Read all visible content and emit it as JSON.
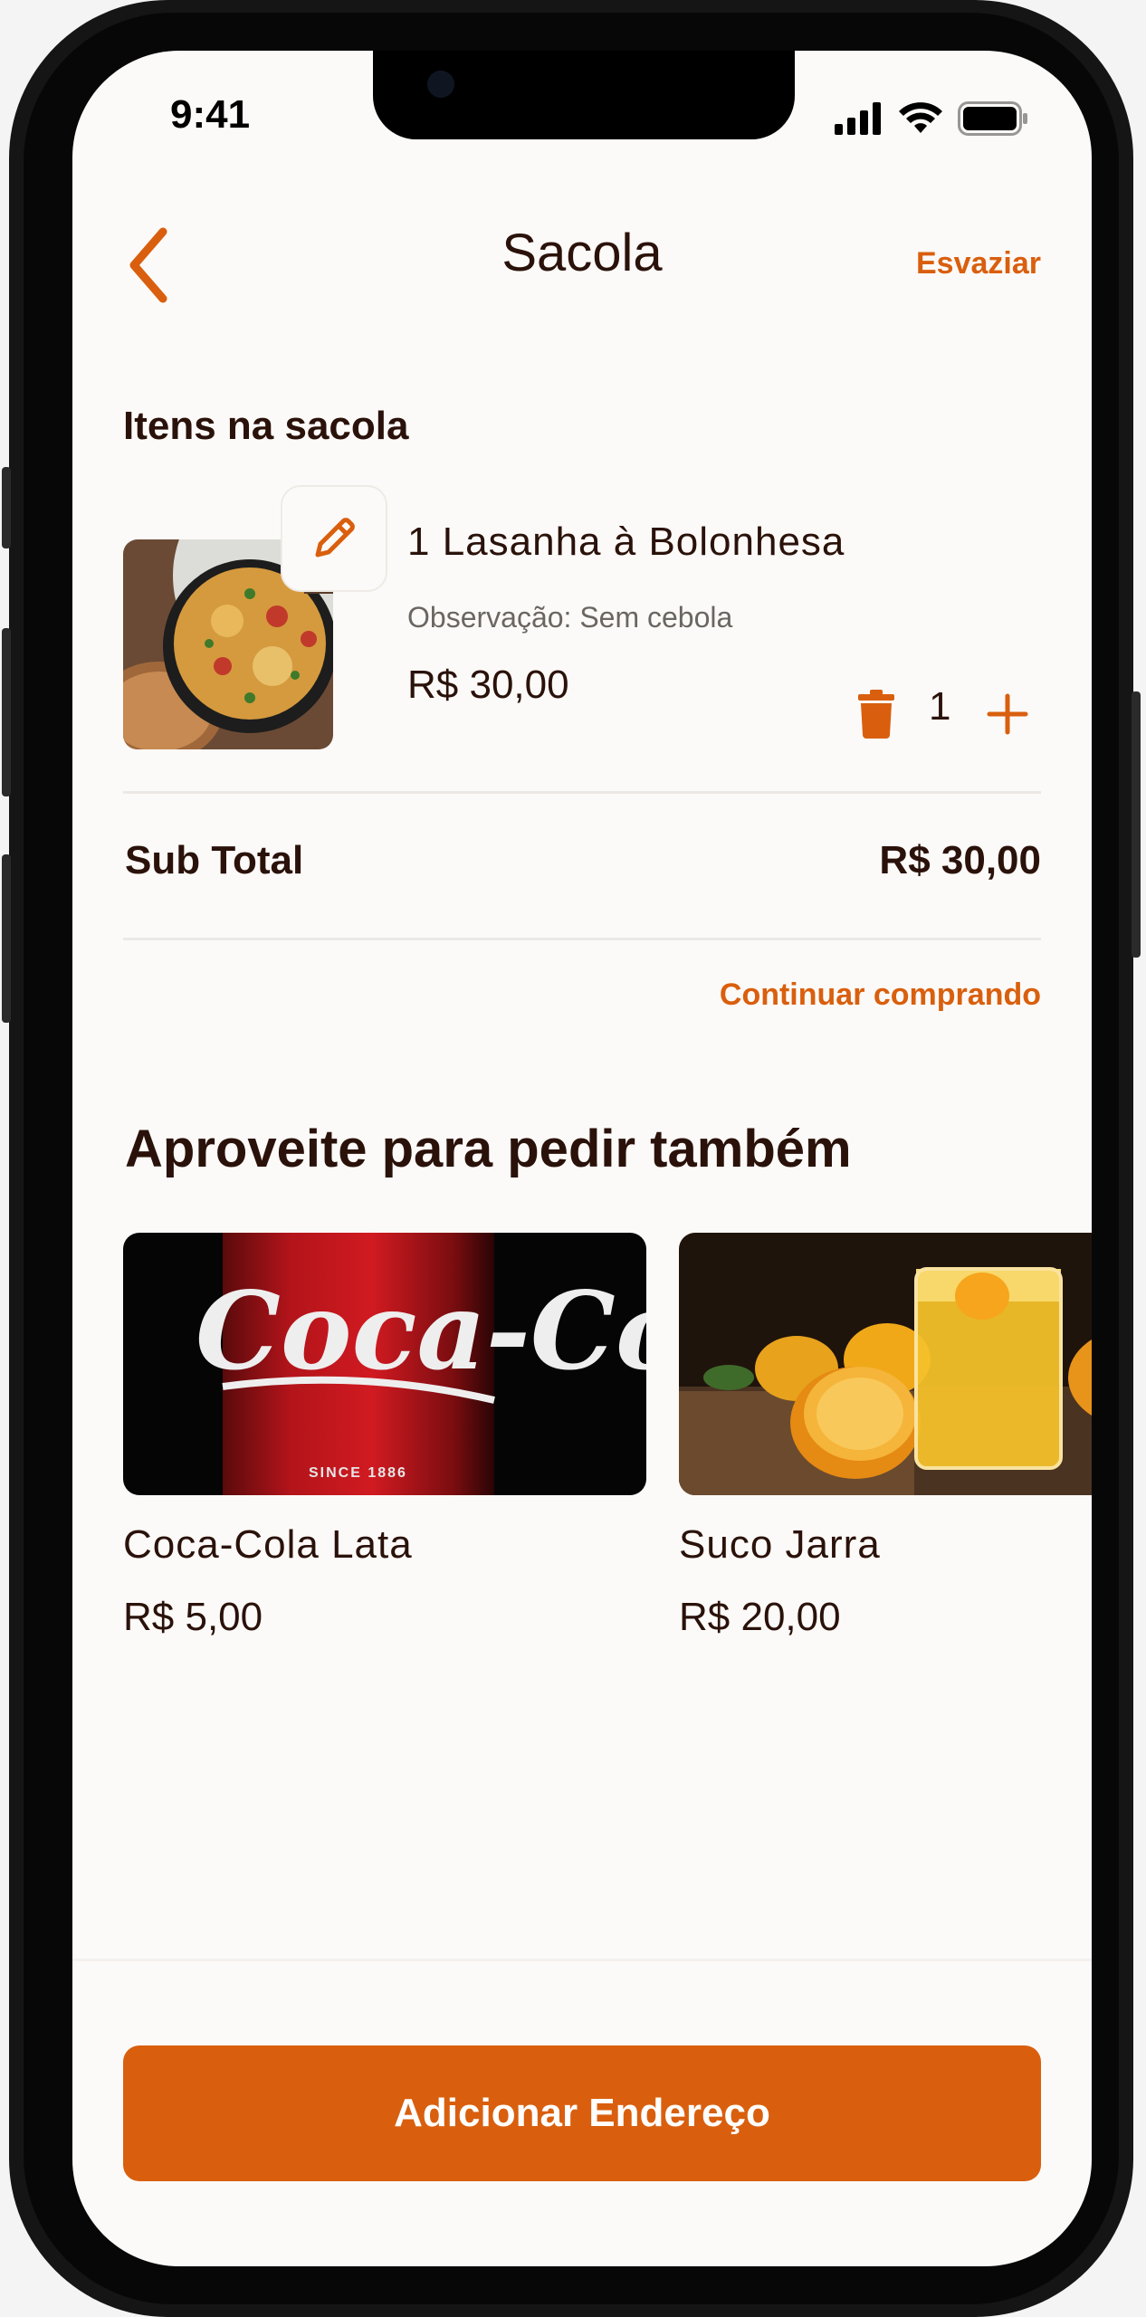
{
  "status_bar": {
    "time": "9:41"
  },
  "header": {
    "title": "Sacola",
    "empty_label": "Esvaziar"
  },
  "bag": {
    "section_title": "Itens na sacola",
    "items": [
      {
        "name": "1 Lasanha à Bolonhesa",
        "note": "Observação: Sem cebola",
        "price": "R$ 30,00",
        "quantity": "1"
      }
    ],
    "subtotal_label": "Sub Total",
    "subtotal_value": "R$ 30,00",
    "continue_label": "Continuar comprando"
  },
  "suggestions": {
    "title": "Aproveite para pedir também",
    "items": [
      {
        "name": "Coca-Cola Lata",
        "price": "R$ 5,00",
        "image_text": "Coca-Co",
        "image_subtext": "SINCE 1886"
      },
      {
        "name": "Suco Jarra",
        "price": "R$ 20,00"
      }
    ]
  },
  "footer": {
    "cta_label": "Adicionar Endereço"
  },
  "colors": {
    "accent": "#d95f0e",
    "text": "#2a120a",
    "background": "#fcfaf8"
  }
}
